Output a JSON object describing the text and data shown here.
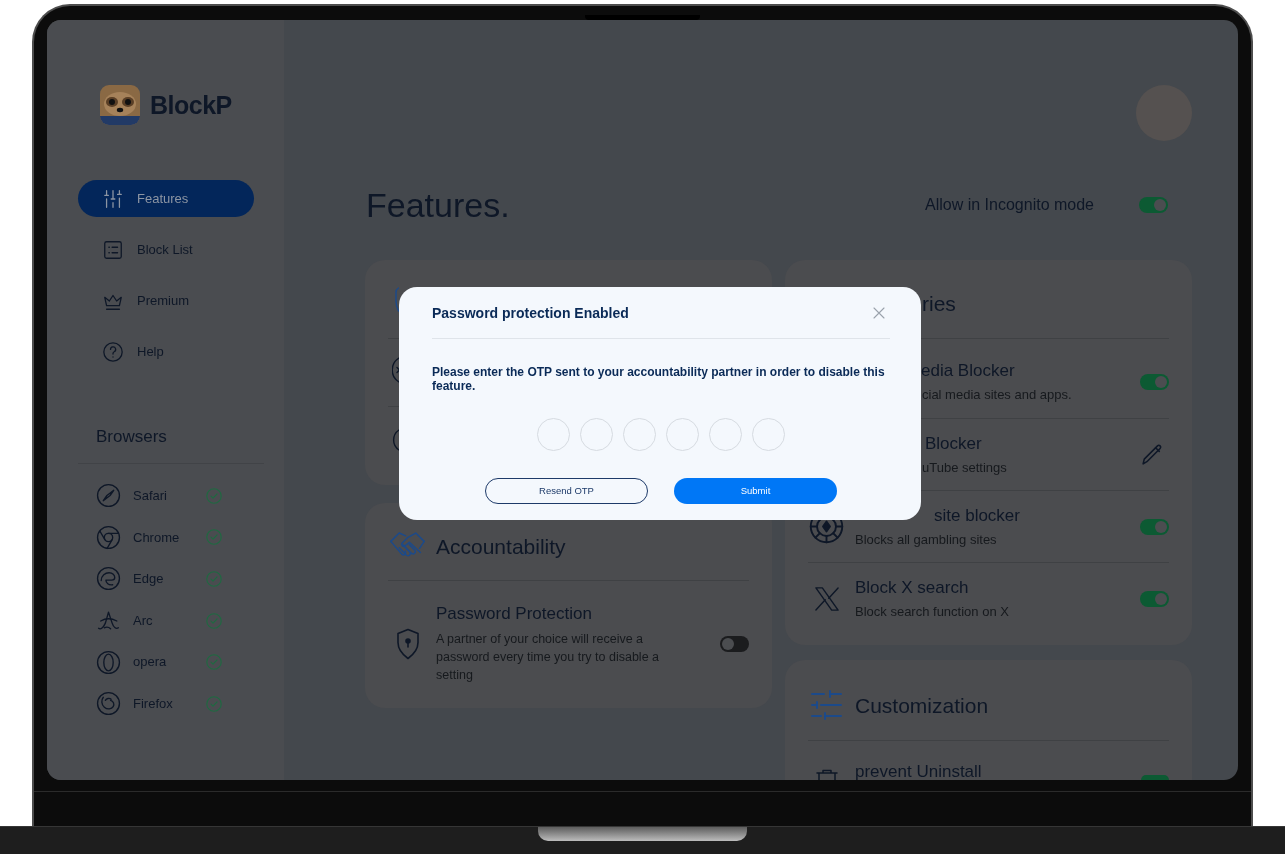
{
  "sidebar": {
    "brand": "BlockP",
    "nav": [
      {
        "label": "Features",
        "selected": true
      },
      {
        "label": "Block List",
        "selected": false
      },
      {
        "label": "Premium",
        "selected": false
      },
      {
        "label": "Help",
        "selected": false
      }
    ],
    "browsers_title": "Browsers",
    "browsers": [
      {
        "name": "Safari",
        "checked": true
      },
      {
        "name": "Chrome",
        "checked": true
      },
      {
        "name": "Edge",
        "checked": true
      },
      {
        "name": "Arc",
        "checked": true
      },
      {
        "name": "opera",
        "checked": true
      },
      {
        "name": "Firefox",
        "checked": true
      }
    ]
  },
  "header": {
    "title": "Features.",
    "incognito": {
      "label": "Allow in Incognito mode",
      "on": true
    }
  },
  "accountability": {
    "title": "Accountability",
    "rows": [
      {
        "title": "Password Protection",
        "description": "A partner of your choice will receive a password every time you try to disable a setting",
        "on": false
      }
    ]
  },
  "categories": {
    "title": "ries",
    "rows": [
      {
        "kind": "toggle",
        "title": "edia Blocker",
        "description": "cial media sites and apps.",
        "on": true
      },
      {
        "kind": "edit",
        "title": "Blocker",
        "description": "uTube settings"
      },
      {
        "kind": "toggle",
        "title": "site blocker",
        "description": "Blocks all gambling sites",
        "on": true
      },
      {
        "kind": "toggle",
        "title": "Block X search",
        "description": "Block search function on X",
        "on": true
      }
    ]
  },
  "customization": {
    "title": "Customization",
    "rows": [
      {
        "kind": "toggle",
        "title": "prevent Uninstall",
        "on": true
      }
    ]
  },
  "modal": {
    "title": "Password protection Enabled",
    "message": "Please enter the OTP sent to your accountability partner in order to disable this feature.",
    "otp_fields": [
      {
        "filled": false
      },
      {
        "filled": false
      },
      {
        "filled": false
      },
      {
        "filled": false
      },
      {
        "filled": false
      },
      {
        "filled": false
      }
    ],
    "buttons": [
      {
        "kind": "outline",
        "label": "Resend OTP"
      },
      {
        "kind": "primary",
        "label": "Submit"
      }
    ]
  }
}
